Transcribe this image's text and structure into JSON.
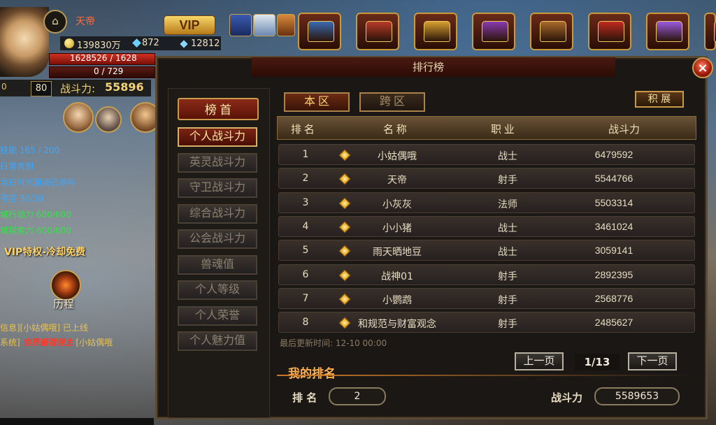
{
  "player": {
    "name": "天帝",
    "vip_label": "VIP",
    "gold": "139830万",
    "gems": "872",
    "crystals": "12812",
    "hp": "1628526 / 1628",
    "mp": "0 / 729",
    "level": "80",
    "power_label": "战斗力:",
    "power_value": "55896",
    "exp_left": "0"
  },
  "quests": [
    {
      "text": "技能 165 / 200",
      "color": "blue"
    },
    {
      "text": "日常务到",
      "color": "blue"
    },
    {
      "text": "当日时光副消已参与",
      "color": "blue"
    },
    {
      "text": "寻宝 30/30",
      "color": "blue"
    },
    {
      "text": "域行动力 600/600",
      "color": "green"
    },
    {
      "text": "域探索力 600/600",
      "color": "green"
    }
  ],
  "vip_privilege": "VIP特权-冷却免费",
  "history_label": "历程",
  "chat": {
    "line1": "信息][小姑偶哦] 已上线",
    "line2_prefix": "系统]",
    "line2_red": "世界最强领主",
    "line2_suffix": "[小姑偶哦"
  },
  "panel": {
    "title": "排行榜",
    "close": "×",
    "tab_local": "本 区",
    "tab_cross": "跨 区",
    "points_button": "积 展",
    "menu_head": "榜 首",
    "menu": [
      {
        "label": "个人战斗力",
        "active": true
      },
      {
        "label": "英灵战斗力",
        "active": false
      },
      {
        "label": "守卫战斗力",
        "active": false
      },
      {
        "label": "综合战斗力",
        "active": false
      },
      {
        "label": "公会战斗力",
        "active": false
      },
      {
        "label": "兽魂值",
        "active": false
      },
      {
        "label": "个人等级",
        "active": false
      },
      {
        "label": "个人荣誉",
        "active": false
      },
      {
        "label": "个人魅力值",
        "active": false
      }
    ],
    "columns": {
      "rank": "排 名",
      "name": "名 称",
      "job": "职 业",
      "power": "战斗力"
    },
    "rows": [
      {
        "rank": "1",
        "name": "小姑偶哦",
        "job": "战士",
        "power": "6479592"
      },
      {
        "rank": "2",
        "name": "天帝",
        "job": "射手",
        "power": "5544766"
      },
      {
        "rank": "3",
        "name": "小灰灰",
        "job": "法师",
        "power": "5503314"
      },
      {
        "rank": "4",
        "name": "小小猪",
        "job": "战士",
        "power": "3461024"
      },
      {
        "rank": "5",
        "name": "雨天晒地豆",
        "job": "战士",
        "power": "3059141"
      },
      {
        "rank": "6",
        "name": "战神01",
        "job": "射手",
        "power": "2892395"
      },
      {
        "rank": "7",
        "name": "小鹦鹉",
        "job": "射手",
        "power": "2568776"
      },
      {
        "rank": "8",
        "name": "和规范与财富观念",
        "job": "射手",
        "power": "2485627"
      }
    ],
    "last_update": "最后更新时间: 12-10 00:00",
    "prev_page": "上一页",
    "next_page": "下一页",
    "page": "1/13",
    "my_rank_title": "我的排名",
    "my_rank_label": "排 名",
    "my_rank_value": "2",
    "my_power_label": "战斗力",
    "my_power_value": "5589653"
  },
  "toolbar": [
    {
      "icon": "treasure-chest-blue",
      "color": "#3a6ab0"
    },
    {
      "icon": "treasure-chest-red",
      "color": "#b83a28"
    },
    {
      "icon": "treasure-chest-gold",
      "color": "#d8a030"
    },
    {
      "icon": "gift-box-purple",
      "color": "#8a3ab0"
    },
    {
      "icon": "treasure-chest-wood",
      "color": "#a86a2a"
    },
    {
      "icon": "treasure-chest-crimson",
      "color": "#c02a20"
    },
    {
      "icon": "crystal-purple",
      "color": "#9a5ae0"
    },
    {
      "icon": "treasure-chest-red-2",
      "color": "#d0402a"
    }
  ],
  "colors": {
    "accent": "#ffcf70",
    "panel_bg": "#1a1714",
    "active_red": "#7a2414"
  }
}
